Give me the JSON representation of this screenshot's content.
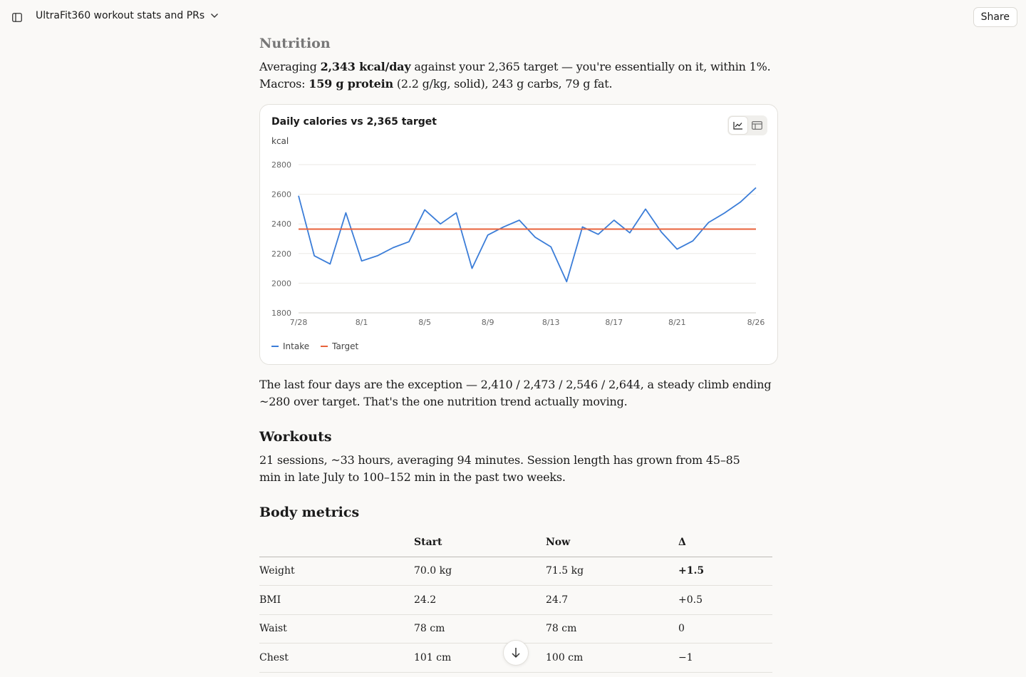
{
  "header": {
    "title": "UltraFit360 workout stats and PRs",
    "share_label": "Share"
  },
  "nutrition": {
    "heading": "Nutrition",
    "p1_a": "Averaging ",
    "p1_b": "2,343 kcal/day",
    "p1_c": " against your 2,365 target — you're essentially on it, within 1%.",
    "p2_a": "Macros: ",
    "p2_b": "159 g protein",
    "p2_c": " (2.2 g/kg, solid), 243 g carbs, 79 g fat.",
    "after_chart": "The last four days are the exception — 2,410 / 2,473 / 2,546 / 2,644, a steady climb ending ~280 over target. That's the one nutrition trend actually moving."
  },
  "chart_data": {
    "type": "line",
    "title": "Daily calories vs 2,365 target",
    "ylabel": "kcal",
    "ylim": [
      1800,
      2800
    ],
    "yticks": [
      1800,
      2000,
      2200,
      2400,
      2600,
      2800
    ],
    "xticks": [
      "7/28",
      "8/1",
      "8/5",
      "8/9",
      "8/13",
      "8/17",
      "8/21",
      "8/26"
    ],
    "x": [
      "7/28",
      "7/29",
      "7/30",
      "7/31",
      "8/1",
      "8/2",
      "8/3",
      "8/4",
      "8/5",
      "8/6",
      "8/7",
      "8/8",
      "8/9",
      "8/10",
      "8/11",
      "8/12",
      "8/13",
      "8/14",
      "8/15",
      "8/16",
      "8/17",
      "8/18",
      "8/19",
      "8/20",
      "8/21",
      "8/22",
      "8/23",
      "8/24",
      "8/25",
      "8/26"
    ],
    "series": [
      {
        "name": "Intake",
        "color": "#3b7dd8",
        "values": [
          2590,
          2185,
          2130,
          2475,
          2150,
          2185,
          2240,
          2280,
          2495,
          2400,
          2475,
          2100,
          2325,
          2380,
          2425,
          2310,
          2245,
          2010,
          2380,
          2330,
          2425,
          2340,
          2500,
          2345,
          2230,
          2285,
          2410,
          2473,
          2546,
          2644
        ]
      },
      {
        "name": "Target",
        "color": "#e8623a",
        "values": [
          2365,
          2365,
          2365,
          2365,
          2365,
          2365,
          2365,
          2365,
          2365,
          2365,
          2365,
          2365,
          2365,
          2365,
          2365,
          2365,
          2365,
          2365,
          2365,
          2365,
          2365,
          2365,
          2365,
          2365,
          2365,
          2365,
          2365,
          2365,
          2365,
          2365
        ]
      }
    ],
    "grid": true,
    "legend": "bottom-left"
  },
  "workouts": {
    "heading": "Workouts",
    "text": "21 sessions, ~33 hours, averaging 94 minutes. Session length has grown from 45–85 min in late July to 100–152 min in the past two weeks."
  },
  "body_metrics": {
    "heading": "Body metrics",
    "columns": [
      "",
      "Start",
      "Now",
      "Δ"
    ],
    "rows": [
      {
        "label": "Weight",
        "start": "70.0 kg",
        "now": "71.5 kg",
        "delta": "+1.5",
        "bold": true
      },
      {
        "label": "BMI",
        "start": "24.2",
        "now": "24.7",
        "delta": "+0.5",
        "bold": false
      },
      {
        "label": "Waist",
        "start": "78 cm",
        "now": "78 cm",
        "delta": "0",
        "bold": false
      },
      {
        "label": "Chest",
        "start": "101 cm",
        "now": "100 cm",
        "delta": "−1",
        "bold": false
      }
    ]
  }
}
